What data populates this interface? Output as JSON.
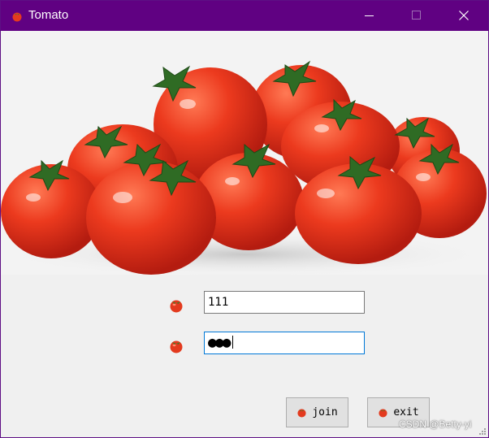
{
  "window": {
    "title": "Tomato",
    "icon": "tomato-icon",
    "controls": [
      "minimize-icon",
      "maximize-icon",
      "close-icon"
    ],
    "accent": "#600182"
  },
  "hero": {
    "image": "tomatoes-photo"
  },
  "form": {
    "username": {
      "value": "111",
      "icon": "tomato-icon"
    },
    "password": {
      "masked": "●●●",
      "icon": "tomato-icon",
      "focused": true
    }
  },
  "buttons": {
    "join": "join",
    "exit": "exit"
  },
  "watermark": "CSDN @Betty-yi"
}
